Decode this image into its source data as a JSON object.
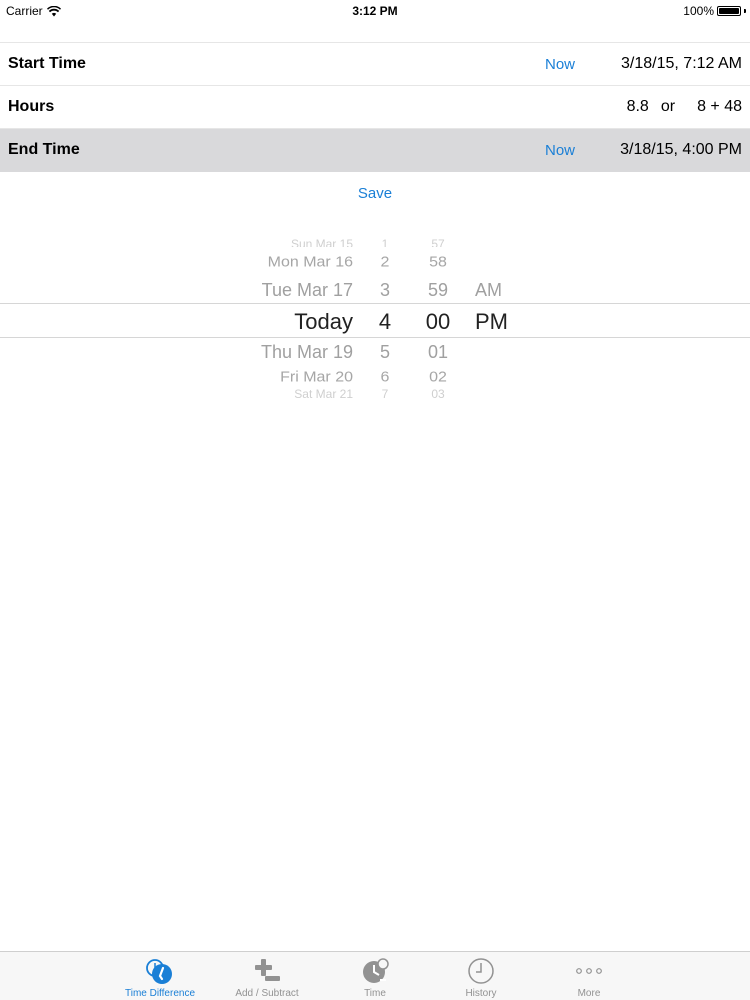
{
  "status_bar": {
    "carrier": "Carrier",
    "time": "3:12 PM",
    "battery": "100%"
  },
  "rows": {
    "start": {
      "label": "Start Time",
      "now": "Now",
      "value": "3/18/15, 7:12 AM"
    },
    "hours": {
      "label": "Hours",
      "decimal": "8.8",
      "or": "or",
      "hm": "8 + 48"
    },
    "end": {
      "label": "End Time",
      "now": "Now",
      "value": "3/18/15, 4:00 PM"
    }
  },
  "save_label": "Save",
  "picker": {
    "dates": [
      "Sun Mar 15",
      "Mon Mar 16",
      "Tue Mar 17",
      "Today",
      "Thu Mar 19",
      "Fri Mar 20",
      "Sat Mar 21"
    ],
    "hours": [
      "1",
      "2",
      "3",
      "4",
      "5",
      "6",
      "7"
    ],
    "minutes": [
      "57",
      "58",
      "59",
      "00",
      "01",
      "02",
      "03"
    ],
    "ampm": [
      "AM",
      "PM"
    ]
  },
  "tabs": [
    {
      "label": "Time Difference",
      "icon": "time-difference-icon",
      "active": true
    },
    {
      "label": "Add / Subtract",
      "icon": "add-subtract-icon",
      "active": false
    },
    {
      "label": "Time",
      "icon": "time-icon",
      "active": false
    },
    {
      "label": "History",
      "icon": "history-clock-icon",
      "active": false
    },
    {
      "label": "More",
      "icon": "more-dots-icon",
      "active": false
    }
  ],
  "colors": {
    "accent": "#1a7fd6",
    "selected_row": "#d9d9db",
    "tab_inactive": "#929292"
  }
}
